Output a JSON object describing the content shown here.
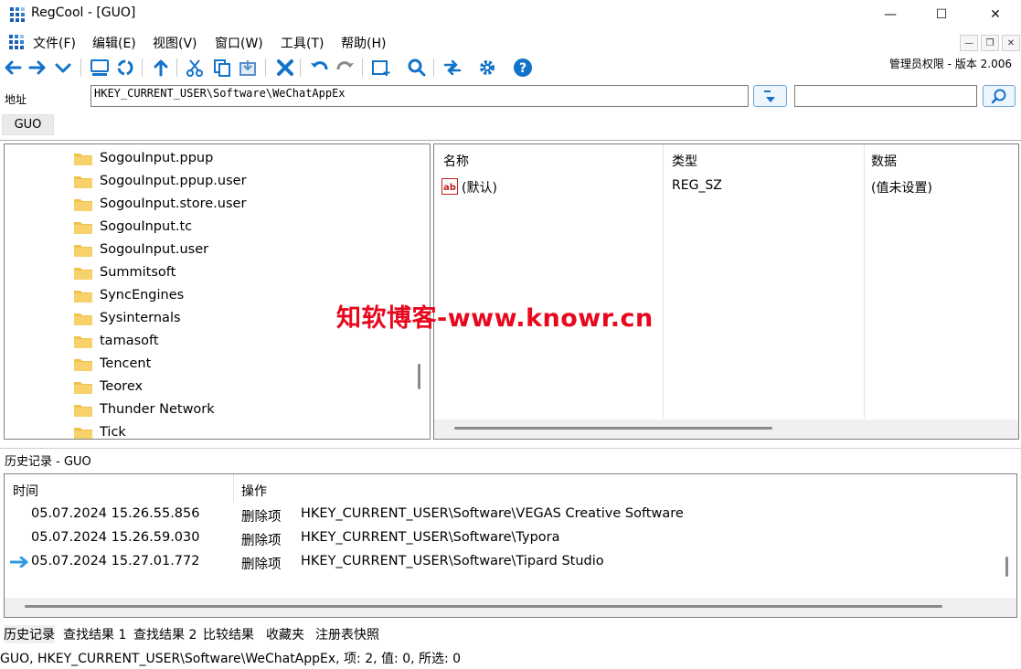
{
  "window": {
    "title": "RegCool - [GUO]",
    "minimize": "—",
    "maximize": "☐",
    "close": "✕"
  },
  "menu": [
    "文件(F)",
    "编辑(E)",
    "视图(V)",
    "窗口(W)",
    "工具(T)",
    "帮助(H)"
  ],
  "mdi": {
    "minimize": "—",
    "restore": "❐",
    "close": "✕"
  },
  "toolbar": {
    "version": "管理员权限 - 版本 2.006"
  },
  "address": {
    "label": "地址",
    "value": "HKEY_CURRENT_USER\\Software\\WeChatAppEx",
    "search_value": ""
  },
  "tab": {
    "label": "GUO"
  },
  "tree": {
    "items": [
      "SogouInput.ppup",
      "SogouInput.ppup.user",
      "SogouInput.store.user",
      "SogouInput.tc",
      "SogouInput.user",
      "Summitsoft",
      "SyncEngines",
      "Sysinternals",
      "tamasoft",
      "Tencent",
      "Teorex",
      "Thunder Network",
      "Tick"
    ]
  },
  "values": {
    "columns": {
      "name": "名称",
      "type": "类型",
      "data": "数据"
    },
    "rows": [
      {
        "icon": "ab",
        "name": "(默认)",
        "type": "REG_SZ",
        "data": "(值未设置)"
      }
    ]
  },
  "watermark": "知软博客-www.knowr.cn",
  "history": {
    "title": "历史记录 - GUO",
    "columns": {
      "time": "时间",
      "op": "操作"
    },
    "rows": [
      {
        "time": "05.07.2024 15.26.55.856",
        "op": "删除项",
        "path": "HKEY_CURRENT_USER\\Software\\VEGAS Creative Software",
        "current": false
      },
      {
        "time": "05.07.2024 15.26.59.030",
        "op": "删除项",
        "path": "HKEY_CURRENT_USER\\Software\\Typora",
        "current": false
      },
      {
        "time": "05.07.2024 15.27.01.772",
        "op": "删除项",
        "path": "HKEY_CURRENT_USER\\Software\\Tipard Studio",
        "current": true
      }
    ]
  },
  "bottom_tabs": [
    "历史记录",
    "查找结果 1",
    "查找结果 2",
    "比较结果",
    "收藏夹",
    "注册表快照"
  ],
  "status": "GUO, HKEY_CURRENT_USER\\Software\\WeChatAppEx, 项: 2, 值: 0, 所选: 0"
}
